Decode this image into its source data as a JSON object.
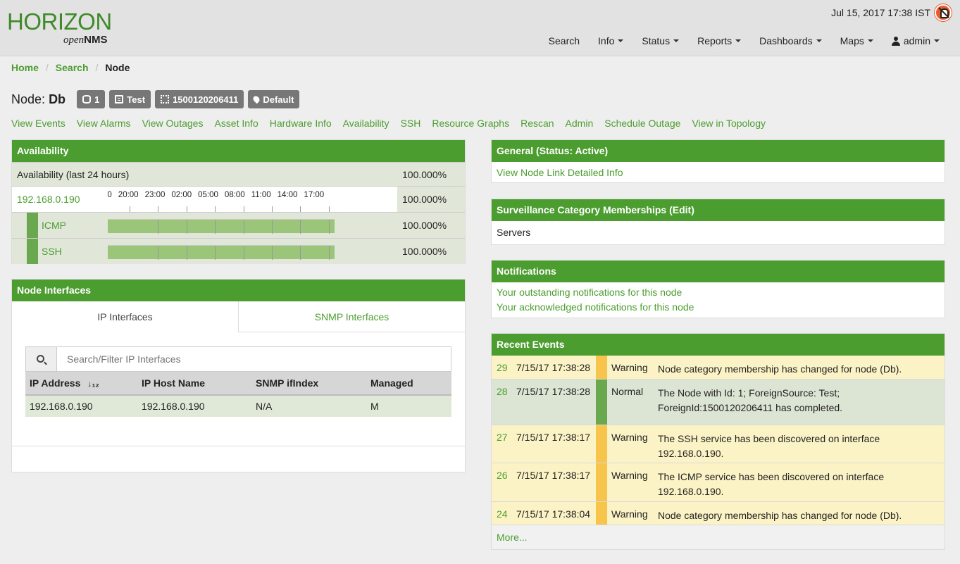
{
  "header": {
    "logo_main": "HORIZON",
    "logo_sub_italic": "open",
    "logo_sub_bold": "NMS",
    "clock": "Jul 15, 2017 17:38 IST",
    "nav": [
      "Search",
      "Info",
      "Status",
      "Reports",
      "Dashboards",
      "Maps"
    ],
    "user": "admin"
  },
  "breadcrumb": {
    "home": "Home",
    "search": "Search",
    "current": "Node"
  },
  "node": {
    "label_prefix": "Node:",
    "name": "Db",
    "badges": {
      "db": "1",
      "source": "Test",
      "foreign_id": "1500120206411",
      "location": "Default"
    }
  },
  "actions": [
    "View Events",
    "View Alarms",
    "View Outages",
    "Asset Info",
    "Hardware Info",
    "Availability",
    "SSH",
    "Resource Graphs",
    "Rescan",
    "Admin",
    "Schedule Outage",
    "View in Topology"
  ],
  "availability": {
    "title": "Availability",
    "summary_label": "Availability (last 24 hours)",
    "summary_pct": "100.000%",
    "interface": {
      "ip": "192.168.0.190",
      "pct": "100.000%"
    },
    "timeline_labels": [
      "00",
      "20:00",
      "23:00",
      "02:00",
      "05:00",
      "08:00",
      "11:00",
      "14:00",
      "17:00"
    ],
    "services": [
      {
        "name": "ICMP",
        "pct": "100.000%",
        "availability_pct": 100
      },
      {
        "name": "SSH",
        "pct": "100.000%",
        "availability_pct": 100
      }
    ]
  },
  "interfaces": {
    "title": "Node Interfaces",
    "tab_ip": "IP Interfaces",
    "tab_snmp": "SNMP Interfaces",
    "search_placeholder": "Search/Filter IP Interfaces",
    "columns": [
      "IP Address",
      "IP Host Name",
      "SNMP ifIndex",
      "Managed"
    ],
    "rows": [
      [
        "192.168.0.190",
        "192.168.0.190",
        "N/A",
        "M"
      ]
    ]
  },
  "general": {
    "title": "General (Status: Active)",
    "link": "View Node Link Detailed Info"
  },
  "surveillance": {
    "title": "Surveillance Category Memberships (Edit)",
    "value": "Servers"
  },
  "notifications": {
    "title": "Notifications",
    "outstanding": "Your outstanding notifications for this node",
    "acknowledged": "Your acknowledged notifications for this node"
  },
  "events": {
    "title": "Recent Events",
    "items": [
      {
        "id": "29",
        "time": "7/15/17 17:38:28",
        "severity": "Warning",
        "message": "Node category membership has changed for node (Db)."
      },
      {
        "id": "28",
        "time": "7/15/17 17:38:28",
        "severity": "Normal",
        "message": "The Node with Id: 1; ForeignSource: Test; ForeignId:1500120206411 has completed."
      },
      {
        "id": "27",
        "time": "7/15/17 17:38:17",
        "severity": "Warning",
        "message": "The SSH service has been discovered on interface 192.168.0.190."
      },
      {
        "id": "26",
        "time": "7/15/17 17:38:17",
        "severity": "Warning",
        "message": "The ICMP service has been discovered on interface 192.168.0.190."
      },
      {
        "id": "24",
        "time": "7/15/17 17:38:04",
        "severity": "Warning",
        "message": "Node category membership has changed for node (Db)."
      }
    ],
    "more": "More..."
  },
  "colors": {
    "accent": "#4c9d2f",
    "warning": "#f7c54c",
    "warning_bg": "#fbf3c6",
    "normal": "#6aa84f"
  }
}
